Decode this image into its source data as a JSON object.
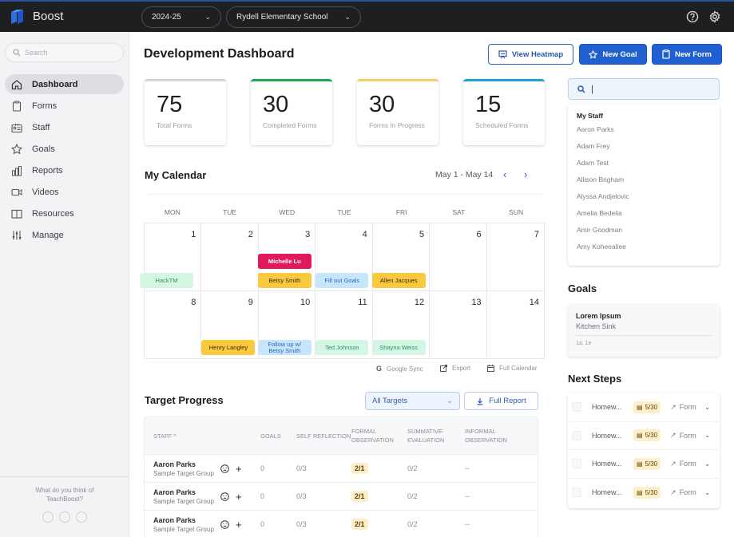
{
  "app": {
    "name": "Boost"
  },
  "topbar": {
    "year": "2024-25",
    "school": "Rydell Elementary School",
    "icons": [
      "help-icon",
      "settings-icon"
    ]
  },
  "sidebar": {
    "search_placeholder": "Search",
    "items": [
      {
        "label": "Dashboard",
        "icon": "home-icon",
        "active": true
      },
      {
        "label": "Forms",
        "icon": "clipboard-icon"
      },
      {
        "label": "Staff",
        "icon": "staff-card-icon"
      },
      {
        "label": "Goals",
        "icon": "star-icon"
      },
      {
        "label": "Reports",
        "icon": "bar-chart-icon"
      },
      {
        "label": "Videos",
        "icon": "video-icon"
      },
      {
        "label": "Resources",
        "icon": "book-icon"
      },
      {
        "label": "Manage",
        "icon": "sliders-icon"
      }
    ],
    "feedback": {
      "line1": "What do you think of",
      "line2": "TeachBoost?"
    }
  },
  "header": {
    "title": "Development Dashboard",
    "buttons": {
      "heatmap": "View Heatmap",
      "new_goal": "New Goal",
      "new_form": "New Form"
    }
  },
  "stats": [
    {
      "value": "75",
      "label": "Total Forms",
      "color": "#d3d8e0"
    },
    {
      "value": "30",
      "label": "Completed Forms",
      "color": "#23a455"
    },
    {
      "value": "30",
      "label": "Forms In Progress",
      "color": "#f8cd6a"
    },
    {
      "value": "15",
      "label": "Scheduled Forms",
      "color": "#1ea0dc"
    }
  ],
  "calendar": {
    "title": "My Calendar",
    "range": "May 1 - May 14",
    "weekdays": [
      "MON",
      "TUE",
      "WED",
      "TUE",
      "FRI",
      "SAT",
      "SUN"
    ],
    "days": [
      "1",
      "2",
      "3",
      "4",
      "5",
      "6",
      "7",
      "8",
      "9",
      "10",
      "11",
      "12",
      "13",
      "14"
    ],
    "events": [
      {
        "label": "HackTM",
        "style": "green"
      },
      {
        "label": "Michelle Lu",
        "style": "pink"
      },
      {
        "label": "Betsy Smith",
        "style": "yellow"
      },
      {
        "label": "Fill out Goals",
        "style": "blue"
      },
      {
        "label": "Allen Jacques",
        "style": "yellow"
      },
      {
        "label": "Henry Langley",
        "style": "yellow"
      },
      {
        "label": "Follow up w/ Betsy Smith",
        "style": "blue"
      },
      {
        "label": "Ted Johnson",
        "style": "green"
      },
      {
        "label": "Shayna Weiss",
        "style": "green"
      }
    ],
    "actions": {
      "google": "Google Sync",
      "export": "Export",
      "full": "Full Calendar"
    }
  },
  "target_progress": {
    "title": "Target Progress",
    "filter": "All Targets",
    "report_button": "Full Report",
    "columns": [
      "STAFF ^",
      "GOALS",
      "SELF REFLECTION",
      "FORMAL OBSERVATION",
      "SUMMATIVE EVALUATION",
      "INFORMAL OBSERVATION"
    ],
    "rows": [
      {
        "name": "Aaron Parks",
        "group": "Sample Target Group",
        "goals": "0",
        "self": "0/3",
        "formal": "2/1",
        "summative": "0/2",
        "informal": "--"
      },
      {
        "name": "Aaron Parks",
        "group": "Sample Target Group",
        "goals": "0",
        "self": "0/3",
        "formal": "2/1",
        "summative": "0/2",
        "informal": "--"
      },
      {
        "name": "Aaron Parks",
        "group": "Sample Target Group",
        "goals": "0",
        "self": "0/3",
        "formal": "2/1",
        "summative": "0/2",
        "informal": "--"
      }
    ]
  },
  "staff_panel": {
    "search_value": "|",
    "heading": "My Staff",
    "names": [
      "Aaron Parks",
      "Adam Frey",
      "Adam Test",
      "Allison Brigham",
      "Alyssa Andjelovic",
      "Amelia Bedelia",
      "Amir Goodman",
      "Amy Koheealiee"
    ]
  },
  "goals": {
    "title": "Goals",
    "card": {
      "title": "Lorem Ipsum",
      "subtitle": "Kitchen Sink",
      "tags": "1a, 1e"
    }
  },
  "next_steps": {
    "title": "Next Steps",
    "items": [
      {
        "name": "Homew...",
        "date": "5/30",
        "link": "Form"
      },
      {
        "name": "Homew...",
        "date": "5/30",
        "link": "Form"
      },
      {
        "name": "Homew...",
        "date": "5/30",
        "link": "Form"
      },
      {
        "name": "Homew...",
        "date": "5/30",
        "link": "Form"
      }
    ]
  }
}
